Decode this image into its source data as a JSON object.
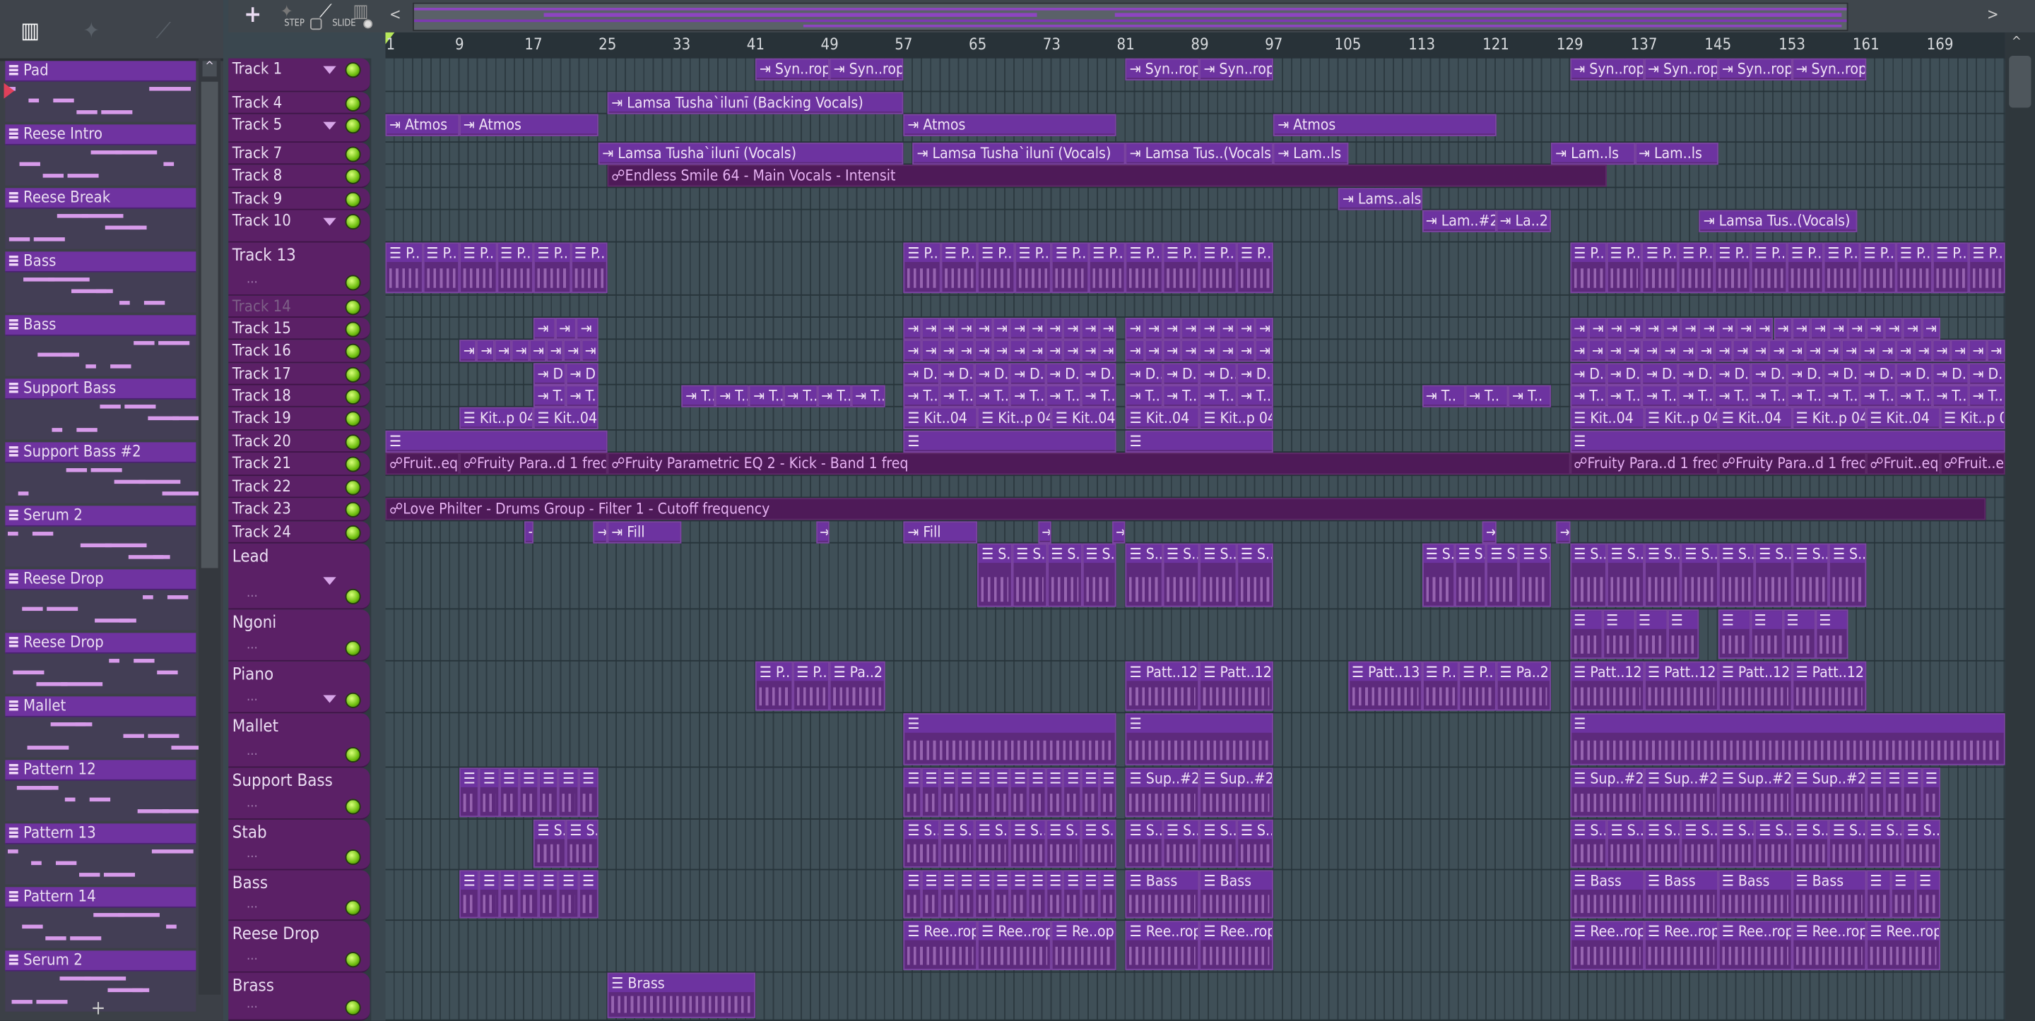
{
  "toolbar": {
    "add": "+",
    "step_label": "STEP",
    "slide_label": "SLIDE",
    "scroll_left": "<",
    "scroll_right": ">"
  },
  "picker": {
    "add": "+",
    "channels": [
      "Pad",
      "Reese Intro",
      "Reese Break",
      "Bass",
      "Bass",
      "Support Bass",
      "Support Bass #2",
      "Serum 2",
      "Reese Drop",
      "Reese Drop",
      "Mallet",
      "Pattern 12",
      "Pattern 13",
      "Pattern 14",
      "Serum 2"
    ]
  },
  "ruler": {
    "bars": [
      1,
      9,
      17,
      25,
      33,
      41,
      49,
      57,
      65,
      73,
      81,
      89,
      97,
      105,
      113,
      121,
      129,
      137,
      145,
      153,
      161,
      169
    ]
  },
  "colors": {
    "clip": "#5d2a7c",
    "clip_header": "#6d33a0",
    "track_header": "#5b2066",
    "led": "#8fdc1e"
  },
  "tracks": [
    {
      "name": "Track 1",
      "dd": true,
      "type": "audio",
      "clips": [
        {
          "s": 41,
          "e": 57,
          "label": "Syn..rop",
          "n": 2
        },
        {
          "s": 81,
          "e": 97,
          "label": "Syn..rop",
          "n": 2
        },
        {
          "s": 129,
          "e": 161,
          "label": "Syn..rop",
          "n": 4
        }
      ]
    },
    {
      "name": "Track 4",
      "type": "audio",
      "clips": [
        {
          "s": 25,
          "e": 57,
          "label": "Lamsa Tusha`ilunī (Backing Vocals)",
          "n": 1
        }
      ]
    },
    {
      "name": "Track 5",
      "dd": true,
      "type": "audio",
      "clips": [
        {
          "s": 1,
          "e": 9,
          "label": "Atmos",
          "n": 1
        },
        {
          "s": 9,
          "e": 24,
          "label": "Atmos",
          "n": 1
        },
        {
          "s": 57,
          "e": 80,
          "label": "Atmos",
          "n": 1
        },
        {
          "s": 97,
          "e": 121,
          "label": "Atmos",
          "n": 1
        }
      ]
    },
    {
      "name": "Track 7",
      "type": "audio",
      "clips": [
        {
          "s": 24,
          "e": 57,
          "label": "Lamsa Tusha`ilunī (Vocals)",
          "n": 1
        },
        {
          "s": 58,
          "e": 81,
          "label": "Lamsa Tusha`ilunī (Vocals)",
          "n": 1
        },
        {
          "s": 81,
          "e": 97,
          "label": "Lamsa Tus..(Vocals)",
          "n": 1
        },
        {
          "s": 97,
          "e": 105,
          "label": "Lam..ls",
          "n": 1
        },
        {
          "s": 127,
          "e": 145,
          "label": "Lam..ls",
          "n": 2
        }
      ]
    },
    {
      "name": "Track 8",
      "type": "auto",
      "clips": [
        {
          "s": 25,
          "e": 133,
          "label": "Endless Smile 64 - Main Vocals - Intensit",
          "n": 1
        }
      ]
    },
    {
      "name": "Track 9",
      "type": "audio",
      "clips": [
        {
          "s": 104,
          "e": 113,
          "label": "Lams..als",
          "n": 1
        }
      ]
    },
    {
      "name": "Track 10",
      "dd": true,
      "type": "audio",
      "clips": [
        {
          "s": 113,
          "e": 121,
          "label": "Lam..#2",
          "n": 1
        },
        {
          "s": 121,
          "e": 127,
          "label": "La..2",
          "n": 1
        },
        {
          "s": 143,
          "e": 160,
          "label": "Lamsa Tus..(Vocals)",
          "n": 1
        }
      ]
    },
    {
      "name": "Track 13",
      "big": true,
      "type": "pattern",
      "clips": [
        {
          "s": 1,
          "e": 25,
          "label": "P..",
          "n": 6
        },
        {
          "s": 57,
          "e": 97,
          "label": "P..",
          "n": 10
        },
        {
          "s": 129,
          "e": 176,
          "label": "P..",
          "n": 12
        }
      ]
    },
    {
      "name": "Track 14",
      "dim": true,
      "type": "pattern",
      "clips": []
    },
    {
      "name": "Track 15",
      "type": "audio",
      "clips": [
        {
          "s": 17,
          "e": 24,
          "label": "",
          "n": 3
        },
        {
          "s": 57,
          "e": 80,
          "label": "",
          "n": 12
        },
        {
          "s": 81,
          "e": 97,
          "label": "",
          "n": 8
        },
        {
          "s": 129,
          "e": 169,
          "label": "",
          "n": 20
        }
      ]
    },
    {
      "name": "Track 16",
      "type": "audio",
      "clips": [
        {
          "s": 9,
          "e": 24,
          "label": "",
          "n": 8
        },
        {
          "s": 57,
          "e": 80,
          "label": "",
          "n": 12
        },
        {
          "s": 81,
          "e": 97,
          "label": "",
          "n": 8
        },
        {
          "s": 129,
          "e": 176,
          "label": "",
          "n": 24
        }
      ]
    },
    {
      "name": "Track 17",
      "type": "audio",
      "clips": [
        {
          "s": 17,
          "e": 24,
          "label": "D..",
          "n": 2
        },
        {
          "s": 57,
          "e": 80,
          "label": "D..",
          "n": 6
        },
        {
          "s": 81,
          "e": 97,
          "label": "D..",
          "n": 4
        },
        {
          "s": 129,
          "e": 176,
          "label": "D..",
          "n": 12
        }
      ]
    },
    {
      "name": "Track 18",
      "type": "audio",
      "clips": [
        {
          "s": 17,
          "e": 24,
          "label": "T..",
          "n": 2
        },
        {
          "s": 33,
          "e": 55,
          "label": "T..",
          "n": 6
        },
        {
          "s": 57,
          "e": 80,
          "label": "T..",
          "n": 6
        },
        {
          "s": 81,
          "e": 97,
          "label": "T..",
          "n": 4
        },
        {
          "s": 113,
          "e": 127,
          "label": "T..",
          "n": 3
        },
        {
          "s": 129,
          "e": 176,
          "label": "T..",
          "n": 12
        }
      ]
    },
    {
      "name": "Track 19",
      "type": "pattern",
      "clips": [
        {
          "s": 9,
          "e": 17,
          "label": "Kit..p 04",
          "n": 1
        },
        {
          "s": 17,
          "e": 24,
          "label": "Kit..04",
          "n": 1
        },
        {
          "s": 57,
          "e": 65,
          "label": "Kit..04",
          "n": 1
        },
        {
          "s": 65,
          "e": 73,
          "label": "Kit..p 04",
          "n": 1
        },
        {
          "s": 73,
          "e": 80,
          "label": "Kit..04",
          "n": 1
        },
        {
          "s": 81,
          "e": 89,
          "label": "Kit..04",
          "n": 1
        },
        {
          "s": 89,
          "e": 97,
          "label": "Kit..p 04",
          "n": 1
        },
        {
          "s": 129,
          "e": 137,
          "label": "Kit..04",
          "n": 1
        },
        {
          "s": 137,
          "e": 145,
          "label": "Kit..p 04",
          "n": 1
        },
        {
          "s": 145,
          "e": 153,
          "label": "Kit..04",
          "n": 1
        },
        {
          "s": 153,
          "e": 161,
          "label": "Kit..p 04",
          "n": 1
        },
        {
          "s": 161,
          "e": 169,
          "label": "Kit..04",
          "n": 1
        },
        {
          "s": 169,
          "e": 176,
          "label": "Kit..p 04",
          "n": 1
        }
      ]
    },
    {
      "name": "Track 20",
      "type": "pattern",
      "clips": [
        {
          "s": 1,
          "e": 25,
          "label": "",
          "n": 1
        },
        {
          "s": 57,
          "e": 80,
          "label": "",
          "n": 1
        },
        {
          "s": 81,
          "e": 97,
          "label": "",
          "n": 1
        },
        {
          "s": 129,
          "e": 176,
          "label": "",
          "n": 1
        }
      ]
    },
    {
      "name": "Track 21",
      "type": "auto",
      "clips": [
        {
          "s": 1,
          "e": 9,
          "label": "Fruit..eq",
          "n": 1
        },
        {
          "s": 9,
          "e": 25,
          "label": "Fruity Para..d 1 freq",
          "n": 1
        },
        {
          "s": 25,
          "e": 129,
          "label": "Fruity Parametric EQ 2 - Kick - Band 1 freq",
          "n": 1
        },
        {
          "s": 129,
          "e": 145,
          "label": "Fruity Para..d 1 freq",
          "n": 1
        },
        {
          "s": 145,
          "e": 161,
          "label": "Fruity Para..d 1 freq",
          "n": 1
        },
        {
          "s": 161,
          "e": 169,
          "label": "Fruit..eq",
          "n": 1
        },
        {
          "s": 169,
          "e": 176,
          "label": "Fruit..eq",
          "n": 1
        }
      ]
    },
    {
      "name": "Track 22",
      "type": "auto",
      "clips": []
    },
    {
      "name": "Track 23",
      "type": "auto",
      "clips": [
        {
          "s": 1,
          "e": 174,
          "label": "Love Philter - Drums Group - Filter 1 - Cutoff frequency",
          "n": 1
        }
      ]
    },
    {
      "name": "Track 24",
      "type": "audio",
      "clips": [
        {
          "s": 16,
          "e": 17,
          "label": "",
          "n": 1
        },
        {
          "s": 23.5,
          "e": 25,
          "label": "",
          "n": 1
        },
        {
          "s": 25,
          "e": 33,
          "label": "Fill",
          "n": 1
        },
        {
          "s": 47.5,
          "e": 49,
          "label": "",
          "n": 1
        },
        {
          "s": 57,
          "e": 65,
          "label": "Fill",
          "n": 1
        },
        {
          "s": 71.5,
          "e": 73,
          "label": "",
          "n": 1
        },
        {
          "s": 79.5,
          "e": 81,
          "label": "",
          "n": 1
        },
        {
          "s": 119.5,
          "e": 121,
          "label": "",
          "n": 1
        },
        {
          "s": 127.5,
          "e": 129,
          "label": "",
          "n": 1
        }
      ]
    },
    {
      "name": "Lead",
      "big": true,
      "dd": true,
      "type": "pattern",
      "clips": [
        {
          "s": 65,
          "e": 80,
          "label": "S..",
          "n": 4
        },
        {
          "s": 81,
          "e": 97,
          "label": "S..",
          "n": 4
        },
        {
          "s": 113,
          "e": 127,
          "label": "S..",
          "n": 4
        },
        {
          "s": 129,
          "e": 161,
          "label": "S..",
          "n": 8
        }
      ]
    },
    {
      "name": "Ngoni",
      "big": true,
      "type": "pattern",
      "clips": [
        {
          "s": 129,
          "e": 143,
          "label": "",
          "n": 4
        },
        {
          "s": 145,
          "e": 159,
          "label": "",
          "n": 4
        }
      ]
    },
    {
      "name": "Piano",
      "big": true,
      "dd": true,
      "type": "pattern",
      "clips": [
        {
          "s": 41,
          "e": 49,
          "label": "P..",
          "n": 2
        },
        {
          "s": 49,
          "e": 55,
          "label": "Pa..2",
          "n": 1
        },
        {
          "s": 81,
          "e": 97,
          "label": "Patt..12",
          "n": 2
        },
        {
          "s": 105,
          "e": 113,
          "label": "Patt..13",
          "n": 1
        },
        {
          "s": 113,
          "e": 121,
          "label": "P..",
          "n": 2
        },
        {
          "s": 121,
          "e": 127,
          "label": "Pa..2",
          "n": 1
        },
        {
          "s": 129,
          "e": 161,
          "label": "Patt..12",
          "n": 4
        }
      ]
    },
    {
      "name": "Mallet",
      "big": true,
      "type": "pattern",
      "clips": [
        {
          "s": 57,
          "e": 80,
          "label": "",
          "n": 1
        },
        {
          "s": 81,
          "e": 97,
          "label": "",
          "n": 1
        },
        {
          "s": 129,
          "e": 176,
          "label": "",
          "n": 1
        }
      ]
    },
    {
      "name": "Support Bass",
      "big": true,
      "type": "pattern",
      "clips": [
        {
          "s": 9,
          "e": 24,
          "label": "",
          "n": 7
        },
        {
          "s": 57,
          "e": 80,
          "label": "",
          "n": 12
        },
        {
          "s": 81,
          "e": 97,
          "label": "Sup..#2",
          "n": 2
        },
        {
          "s": 129,
          "e": 161,
          "label": "Sup..#2",
          "n": 4
        },
        {
          "s": 161,
          "e": 169,
          "label": "",
          "n": 4
        }
      ]
    },
    {
      "name": "Stab",
      "big": true,
      "type": "pattern",
      "clips": [
        {
          "s": 17,
          "e": 24,
          "label": "S..",
          "n": 2
        },
        {
          "s": 57,
          "e": 80,
          "label": "S..",
          "n": 6
        },
        {
          "s": 81,
          "e": 97,
          "label": "S..",
          "n": 4
        },
        {
          "s": 129,
          "e": 169,
          "label": "S..",
          "n": 10
        }
      ]
    },
    {
      "name": "Bass",
      "big": true,
      "type": "pattern",
      "clips": [
        {
          "s": 9,
          "e": 24,
          "label": "",
          "n": 7
        },
        {
          "s": 57,
          "e": 80,
          "label": "",
          "n": 12
        },
        {
          "s": 81,
          "e": 97,
          "label": "Bass",
          "n": 2
        },
        {
          "s": 129,
          "e": 161,
          "label": "Bass",
          "n": 4
        },
        {
          "s": 161,
          "e": 169,
          "label": "",
          "n": 3
        }
      ]
    },
    {
      "name": "Reese Drop",
      "big": true,
      "type": "pattern",
      "clips": [
        {
          "s": 57,
          "e": 65,
          "label": "Ree..rop",
          "n": 1
        },
        {
          "s": 65,
          "e": 73,
          "label": "Ree..rop",
          "n": 1
        },
        {
          "s": 73,
          "e": 80,
          "label": "Re..op",
          "n": 1
        },
        {
          "s": 81,
          "e": 97,
          "label": "Ree..rop",
          "n": 2
        },
        {
          "s": 129,
          "e": 169,
          "label": "Ree..rop",
          "n": 5
        }
      ]
    },
    {
      "name": "Brass",
      "big": true,
      "type": "pattern",
      "clips": [
        {
          "s": 25,
          "e": 41,
          "label": "Brass",
          "n": 1
        }
      ]
    }
  ]
}
